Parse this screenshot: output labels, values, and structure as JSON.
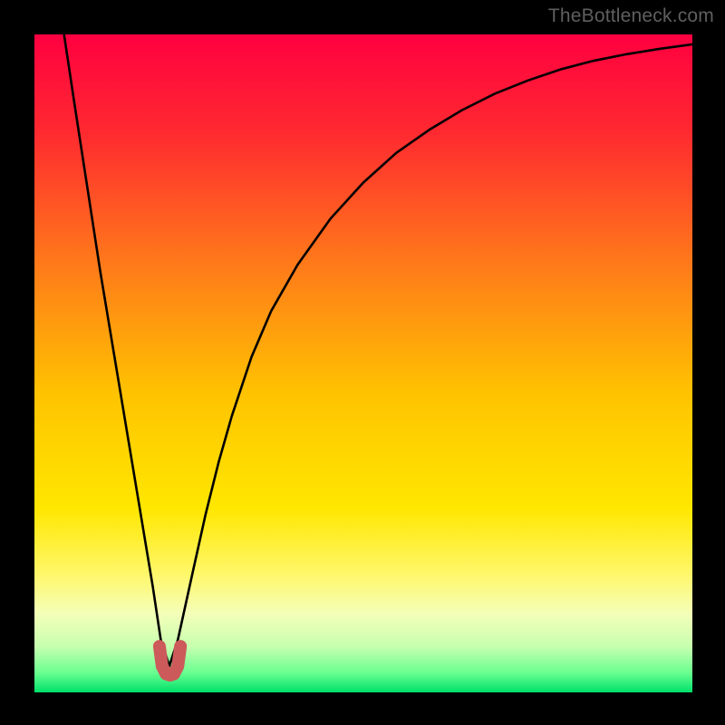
{
  "watermark": "TheBottleneck.com",
  "chart_data": {
    "type": "line",
    "title": "",
    "xlabel": "",
    "ylabel": "",
    "xlim": [
      0,
      100
    ],
    "ylim": [
      0,
      100
    ],
    "background_gradient": {
      "stops": [
        {
          "offset": 0.0,
          "color": "#ff0040"
        },
        {
          "offset": 0.15,
          "color": "#ff2a30"
        },
        {
          "offset": 0.35,
          "color": "#ff7a1a"
        },
        {
          "offset": 0.55,
          "color": "#ffc400"
        },
        {
          "offset": 0.72,
          "color": "#ffe700"
        },
        {
          "offset": 0.82,
          "color": "#fff76a"
        },
        {
          "offset": 0.88,
          "color": "#f4ffb8"
        },
        {
          "offset": 0.93,
          "color": "#c8ffb0"
        },
        {
          "offset": 0.97,
          "color": "#6aff90"
        },
        {
          "offset": 1.0,
          "color": "#00e06a"
        }
      ]
    },
    "series": [
      {
        "name": "curve",
        "color": "#000000",
        "width": 2.6,
        "x": [
          4.5,
          6,
          8,
          10,
          12,
          14,
          16,
          18,
          19.2,
          20.5,
          21.8,
          24,
          26,
          28,
          30,
          33,
          36,
          40,
          45,
          50,
          55,
          60,
          65,
          70,
          75,
          80,
          85,
          90,
          95,
          100
        ],
        "y": [
          100,
          90,
          77,
          64,
          52,
          40,
          28,
          16,
          8,
          4,
          8,
          18,
          27,
          35,
          42,
          51,
          58,
          65,
          72,
          77.5,
          82,
          85.5,
          88.5,
          91,
          93,
          94.7,
          96,
          97,
          97.8,
          98.5
        ]
      },
      {
        "name": "bottom-marker",
        "color": "#cc5a5a",
        "width": 14,
        "linecap": "round",
        "x": [
          19.0,
          19.4,
          20.0,
          20.6,
          21.2,
          21.8,
          22.2
        ],
        "y": [
          7.0,
          4.0,
          2.8,
          2.6,
          2.8,
          4.0,
          7.0
        ]
      }
    ]
  }
}
